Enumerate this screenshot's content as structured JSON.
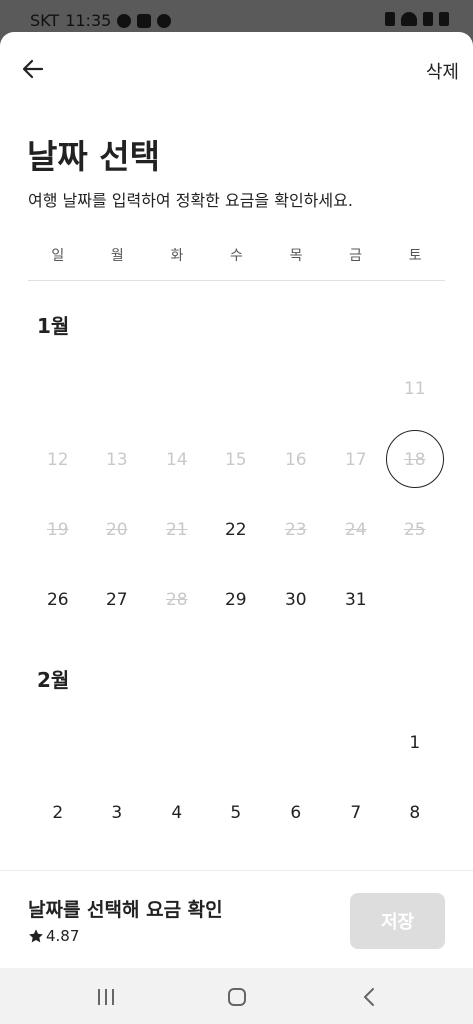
{
  "status_bar": {
    "carrier": "SKT",
    "time": "11:35"
  },
  "header": {
    "delete_label": "삭제"
  },
  "title": "날짜 선택",
  "subtitle": "여행 날짜를 입력하여 정확한 요금을 확인하세요.",
  "weekdays": [
    "일",
    "월",
    "화",
    "수",
    "목",
    "금",
    "토"
  ],
  "months": [
    {
      "label": "1월",
      "rows": [
        [
          null,
          null,
          null,
          null,
          null,
          null,
          "11"
        ],
        [
          "12",
          "13",
          "14",
          "15",
          "16",
          "17",
          "18"
        ],
        [
          "19",
          "20",
          "21",
          "22",
          "23",
          "24",
          "25"
        ],
        [
          "26",
          "27",
          "28",
          "29",
          "30",
          "31",
          null
        ]
      ]
    },
    {
      "label": "2월",
      "rows": [
        [
          null,
          null,
          null,
          null,
          null,
          null,
          "1"
        ],
        [
          "2",
          "3",
          "4",
          "5",
          "6",
          "7",
          "8"
        ]
      ]
    }
  ],
  "footer": {
    "prompt": "날짜를 선택해 요금 확인",
    "rating": "4.87",
    "save_label": "저장"
  },
  "colors": {
    "enabled": "#222222",
    "disabled": "#c9c9c9",
    "save_bg": "#dddddd"
  }
}
